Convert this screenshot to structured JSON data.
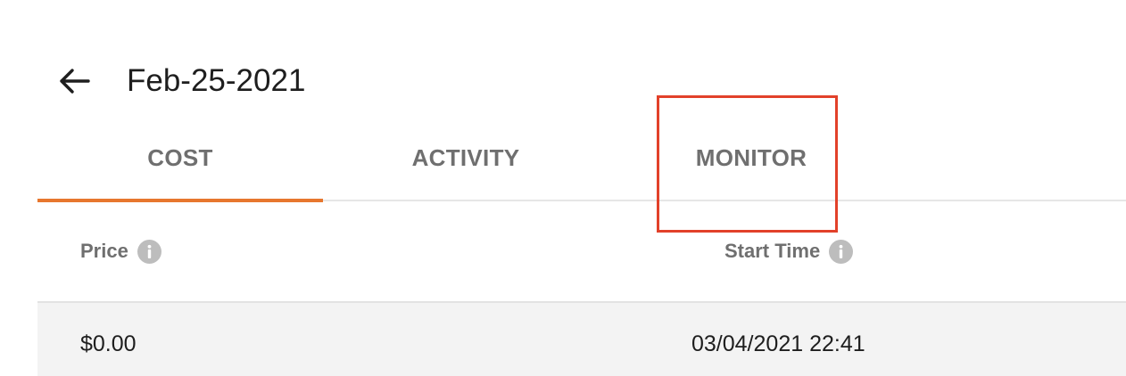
{
  "header": {
    "back_icon": "arrow-left-icon",
    "title": "Feb-25-2021"
  },
  "tabs": [
    {
      "label": "COST",
      "active": true
    },
    {
      "label": "ACTIVITY",
      "active": false
    },
    {
      "label": "MONITOR",
      "active": false,
      "highlighted": true
    }
  ],
  "table": {
    "columns": [
      {
        "label": "Price",
        "icon": "info-icon"
      },
      {
        "label": "Start Time",
        "icon": "info-icon"
      }
    ],
    "rows": [
      {
        "price": "$0.00",
        "start_time": "03/04/2021 22:41"
      }
    ]
  },
  "colors": {
    "accent": "#e7772e",
    "highlight": "#e2412a"
  }
}
